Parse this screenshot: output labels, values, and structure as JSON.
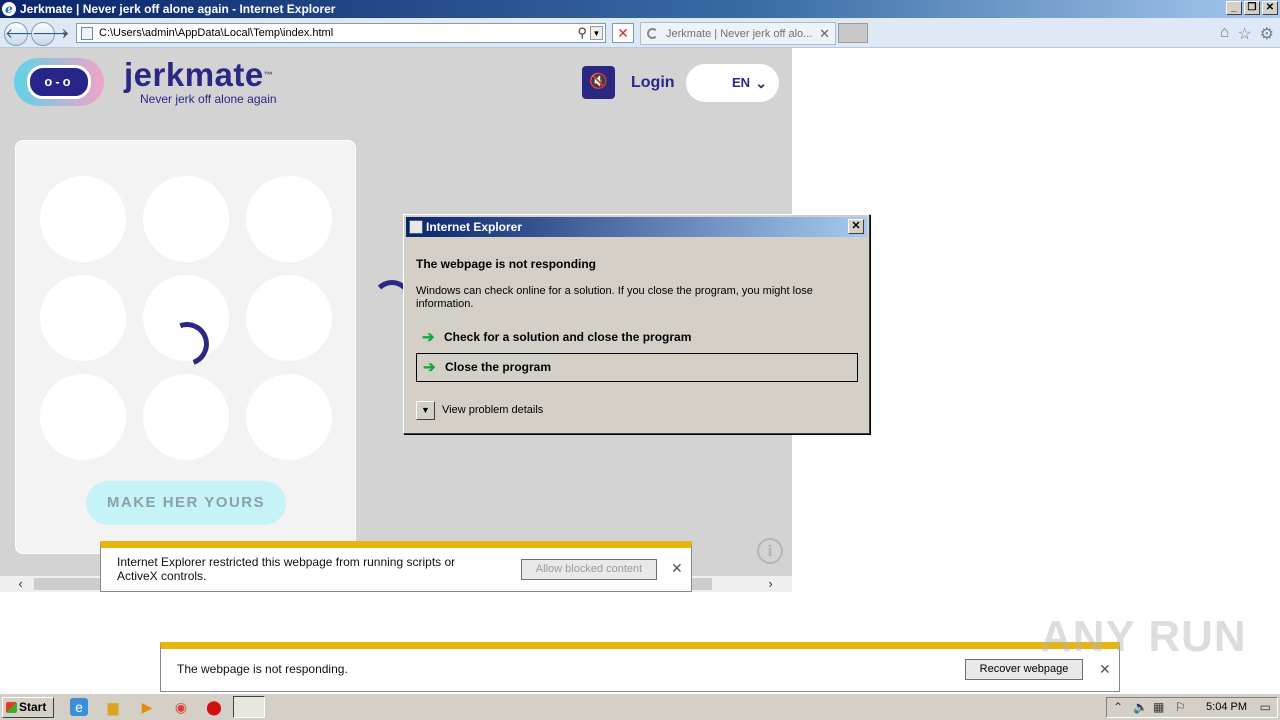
{
  "window": {
    "title": "Jerkmate | Never jerk off alone again - Internet Explorer"
  },
  "nav": {
    "address": "C:\\Users\\admin\\AppData\\Local\\Temp\\index.html",
    "tab_title": "Jerkmate | Never jerk off alo..."
  },
  "page": {
    "brand": "jerkmate",
    "trademark": "™",
    "tagline": "Never jerk off alone again",
    "login": "Login",
    "language": "EN",
    "cta": "MAKE HER YOURS"
  },
  "script_bar": {
    "message": "Internet Explorer restricted this webpage from running scripts or ActiveX controls.",
    "button": "Allow blocked content"
  },
  "recover_bar": {
    "message": "The webpage is not responding.",
    "button": "Recover webpage"
  },
  "dialog": {
    "title": "Internet Explorer",
    "heading": "The webpage is not responding",
    "text": "Windows can check online for a solution. If you close the program, you might lose information.",
    "option_check": "Check for a solution and close the program",
    "option_close": "Close the program",
    "details": "View problem details"
  },
  "taskbar": {
    "start": "Start",
    "clock": "5:04 PM"
  },
  "watermark": "ANY RUN",
  "colors": {
    "brand_navy": "#2b2883",
    "cta_bg": "#c6f3f8",
    "infobar_accent": "#e8b50d"
  }
}
